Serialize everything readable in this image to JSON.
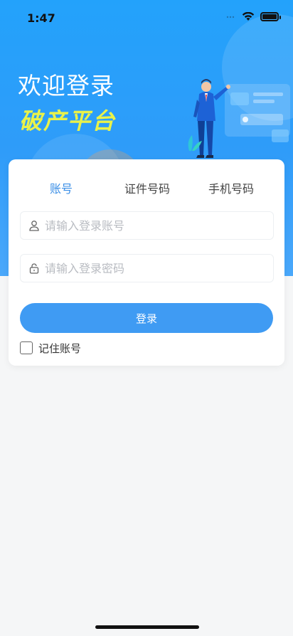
{
  "status_bar": {
    "time": "1:47"
  },
  "hero": {
    "welcome": "欢迎登录",
    "subtitle": "破产平台"
  },
  "tabs": [
    {
      "label": "账号",
      "active": true
    },
    {
      "label": "证件号码",
      "active": false
    },
    {
      "label": "手机号码",
      "active": false
    }
  ],
  "form": {
    "account_placeholder": "请输入登录账号",
    "account_value": "",
    "password_placeholder": "请输入登录密码",
    "password_value": "",
    "login_label": "登录",
    "remember_label": "记住账号",
    "remember_checked": false
  },
  "icons": {
    "account": "user-icon",
    "password": "lock-icon"
  },
  "colors": {
    "accent": "#3f9bf3",
    "active_tab": "#3a8ee6",
    "hero_bg": "#23a2fb",
    "subtitle": "#e9f24a"
  }
}
